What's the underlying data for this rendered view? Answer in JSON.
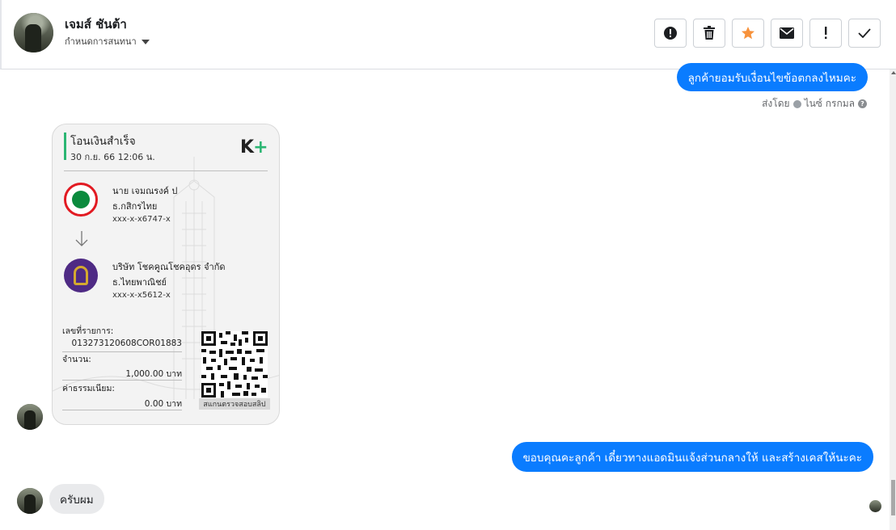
{
  "header": {
    "contact_name": "เจมส์ ชันต้า",
    "subtitle": "กำหนดการสนทนา",
    "avatar_icon": "user-avatar-photo",
    "actions": [
      {
        "name": "report-spam-button",
        "icon": "alert-circle-icon"
      },
      {
        "name": "delete-button",
        "icon": "trash-icon"
      },
      {
        "name": "star-button",
        "icon": "star-icon",
        "color": "#f7923b"
      },
      {
        "name": "mark-unread-button",
        "icon": "envelope-icon"
      },
      {
        "name": "follow-up-button",
        "icon": "exclamation-icon"
      },
      {
        "name": "mark-done-button",
        "icon": "check-icon"
      }
    ]
  },
  "messages": {
    "out_1": "ลูกค้ายอมรับเงื่อนไขข้อตกลงไหมคะ",
    "sent_by_prefix": "ส่งโดย",
    "sent_by_name": "ไนซ์ กรกมล",
    "out_2": "ขอบคุณคะลูกค้า เดี๋ยวทางแอดมินแจ้งส่วนกลางให้ และสร้างเคสให้นะคะ",
    "in_1": "ครับผม"
  },
  "slip": {
    "title": "โอนเงินสำเร็จ",
    "datetime": "30 ก.ย. 66  12:06 น.",
    "logo_k": "K",
    "logo_plus": "+",
    "from_name": "นาย เจมณรงค์ ป",
    "from_bank": "ธ.กสิกรไทย",
    "from_account": "xxx-x-x6747-x",
    "to_name": "บริษัท โชคคูณโชคอุดร จำกัด",
    "to_bank": "ธ.ไทยพาณิชย์",
    "to_account": "xxx-x-x5612-x",
    "ref_label": "เลขที่รายการ:",
    "ref_value": "013273120608COR01883",
    "amount_label": "จำนวน:",
    "amount_value": "1,000.00 บาท",
    "fee_label": "ค่าธรรมเนียม:",
    "fee_value": "0.00 บาท",
    "qr_caption": "สแกนตรวจสอบสลิป"
  },
  "colors": {
    "outgoing_bubble": "#0a7cff",
    "incoming_bubble": "#e9eaec",
    "kbank_green": "#0b8a3d",
    "scb_purple": "#4e2a84"
  }
}
